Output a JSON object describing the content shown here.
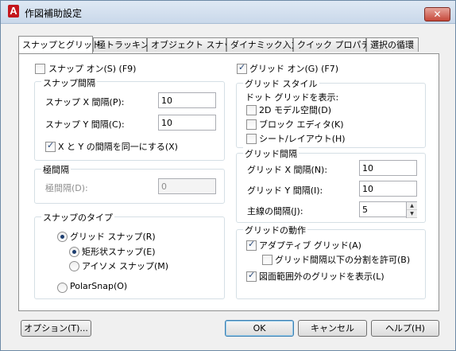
{
  "window": {
    "title": "作図補助設定",
    "close_label": "✕"
  },
  "tabs": [
    "スナップとグリッド",
    "極トラッキング",
    "オブジェクト スナップ",
    "ダイナミック入力",
    "クイック プロパティ",
    "選択の循環"
  ],
  "snap": {
    "toggle_label": "スナップ オン(S) (F9)",
    "toggle_checked": false,
    "spacing": {
      "title": "スナップ間隔",
      "x_label": "スナップ X 間隔(P):",
      "x_value": "10",
      "y_label": "スナップ Y 間隔(C):",
      "y_value": "10",
      "equal_label": "X と Y の間隔を同一にする(X)",
      "equal_checked": true
    },
    "polar": {
      "title": "極間隔",
      "distance_label": "極間隔(D):",
      "distance_value": "0"
    },
    "type": {
      "title": "スナップのタイプ",
      "grid_snap_label": "グリッド スナップ(R)",
      "rect_label": "矩形状スナップ(E)",
      "iso_label": "アイソメ スナップ(M)",
      "polarsnap_label": "PolarSnap(O)"
    }
  },
  "grid": {
    "toggle_label": "グリッド オン(G) (F7)",
    "toggle_checked": true,
    "style": {
      "title": "グリッド スタイル",
      "subtitle": "ドット グリッドを表示:",
      "model_label": "2D モデル空間(D)",
      "block_label": "ブロック エディタ(K)",
      "sheet_label": "シート/レイアウト(H)"
    },
    "spacing": {
      "title": "グリッド間隔",
      "x_label": "グリッド X 間隔(N):",
      "x_value": "10",
      "y_label": "グリッド Y 間隔(I):",
      "y_value": "10",
      "major_label": "主線の間隔(J):",
      "major_value": "5"
    },
    "behavior": {
      "title": "グリッドの動作",
      "adaptive_label": "アダプティブ グリッド(A)",
      "adaptive_checked": true,
      "subdivide_label": "グリッド間隔以下の分割を許可(B)",
      "subdivide_checked": false,
      "beyond_label": "図面範囲外のグリッドを表示(L)",
      "beyond_checked": true
    }
  },
  "buttons": {
    "options": "オプション(T)...",
    "ok": "OK",
    "cancel": "キャンセル",
    "help": "ヘルプ(H)"
  }
}
